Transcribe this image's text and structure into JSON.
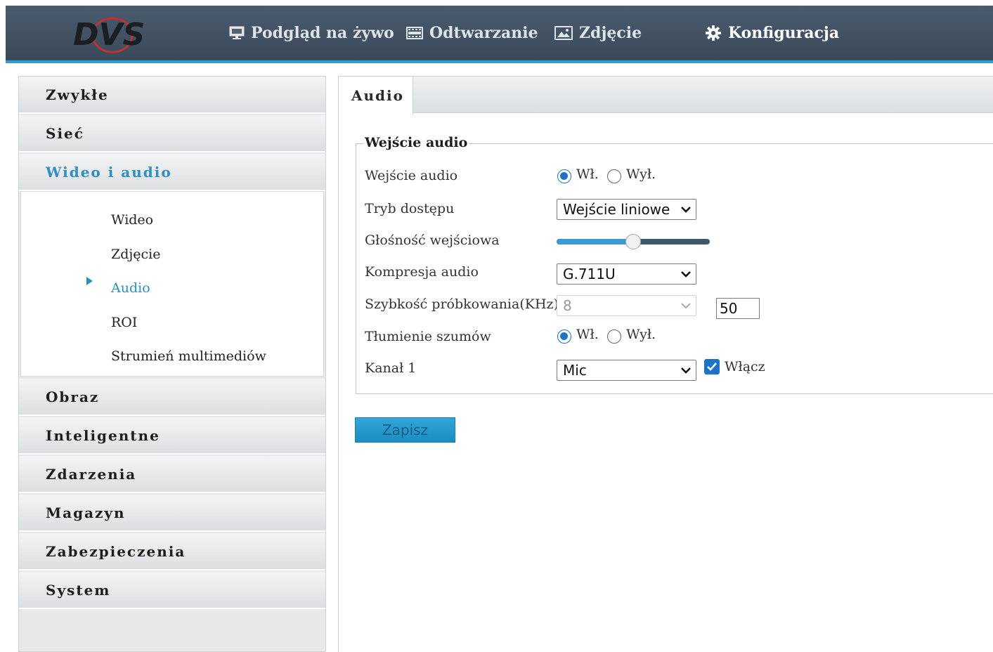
{
  "header": {
    "logo_text": "DVS",
    "nav": [
      {
        "label": "Podgląd na żywo",
        "icon": "monitor-icon"
      },
      {
        "label": "Odtwarzanie",
        "icon": "film-icon"
      },
      {
        "label": "Zdjęcie",
        "icon": "image-icon"
      },
      {
        "label": "Konfiguracja",
        "icon": "gear-icon",
        "active": true
      }
    ]
  },
  "sidebar": {
    "sections": [
      {
        "label": "Zwykłe"
      },
      {
        "label": "Sieć"
      },
      {
        "label": "Wideo i audio",
        "active": true
      },
      {
        "label": "Obraz"
      },
      {
        "label": "Inteligentne"
      },
      {
        "label": "Zdarzenia"
      },
      {
        "label": "Magazyn"
      },
      {
        "label": "Zabezpieczenia"
      },
      {
        "label": "System"
      }
    ],
    "subitems": [
      {
        "label": "Wideo"
      },
      {
        "label": "Zdjęcie"
      },
      {
        "label": "Audio",
        "active": true
      },
      {
        "label": "ROI"
      },
      {
        "label": "Strumień multimediów"
      }
    ]
  },
  "main": {
    "tab_label": "Audio",
    "group_title": "Wejście audio",
    "fields": {
      "audio_input": {
        "label": "Wejście audio",
        "on_label": "Wł.",
        "off_label": "Wył.",
        "value": "on"
      },
      "access_mode": {
        "label": "Tryb dostępu",
        "value": "Wejście liniowe"
      },
      "input_volume": {
        "label": "Głośność wejściowa",
        "value": "50",
        "fraction": 0.5
      },
      "audio_compression": {
        "label": "Kompresja audio",
        "value": "G.711U"
      },
      "sample_rate": {
        "label": "Szybkość próbkowania(KHz)",
        "value": "8",
        "disabled": true
      },
      "noise_suppression": {
        "label": "Tłumienie szumów",
        "on_label": "Wł.",
        "off_label": "Wył.",
        "value": "on"
      },
      "channel1": {
        "label": "Kanał 1",
        "value": "Mic",
        "enable_label": "Włącz",
        "enabled": true
      }
    },
    "save_label": "Zapisz"
  },
  "colors": {
    "header_bg": "#3f5062",
    "accent": "#2f9ed0",
    "active_text": "#2f8fc1",
    "radio_checked": "#1f73c7"
  }
}
